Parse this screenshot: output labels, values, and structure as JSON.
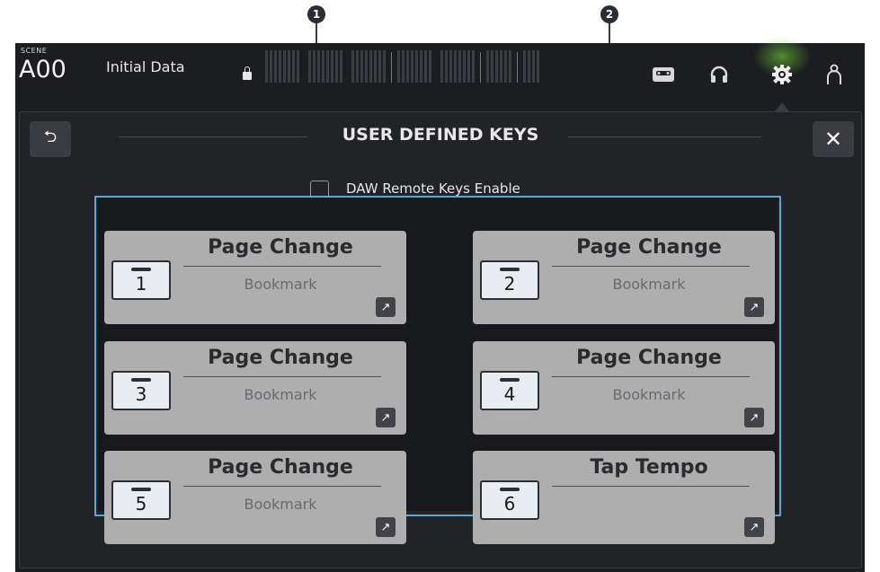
{
  "callouts": [
    "1",
    "2"
  ],
  "header": {
    "scene_label": "SCENE",
    "scene_number": "A00",
    "scene_title": "Initial Data"
  },
  "top_icons": [
    "recorder-icon",
    "headphones-icon",
    "gear-icon",
    "user-icon"
  ],
  "dialog": {
    "title": "USER DEFINED KEYS",
    "back_symbol": "⮌",
    "close_symbol": "✕",
    "checkbox_label": "DAW Remote Keys Enable",
    "checkbox_checked": false
  },
  "keys": [
    {
      "number": "1",
      "function": "Page Change",
      "parameter": "Bookmark"
    },
    {
      "number": "2",
      "function": "Page Change",
      "parameter": "Bookmark"
    },
    {
      "number": "3",
      "function": "Page Change",
      "parameter": "Bookmark"
    },
    {
      "number": "4",
      "function": "Page Change",
      "parameter": "Bookmark"
    },
    {
      "number": "5",
      "function": "Page Change",
      "parameter": "Bookmark"
    },
    {
      "number": "6",
      "function": "Tap Tempo",
      "parameter": ""
    }
  ],
  "colors": {
    "screen_bg": "#1c1d21",
    "key_bg": "#aeaeae",
    "highlight_border": "#5aa7d8",
    "gear_glow": "#78e63c"
  }
}
